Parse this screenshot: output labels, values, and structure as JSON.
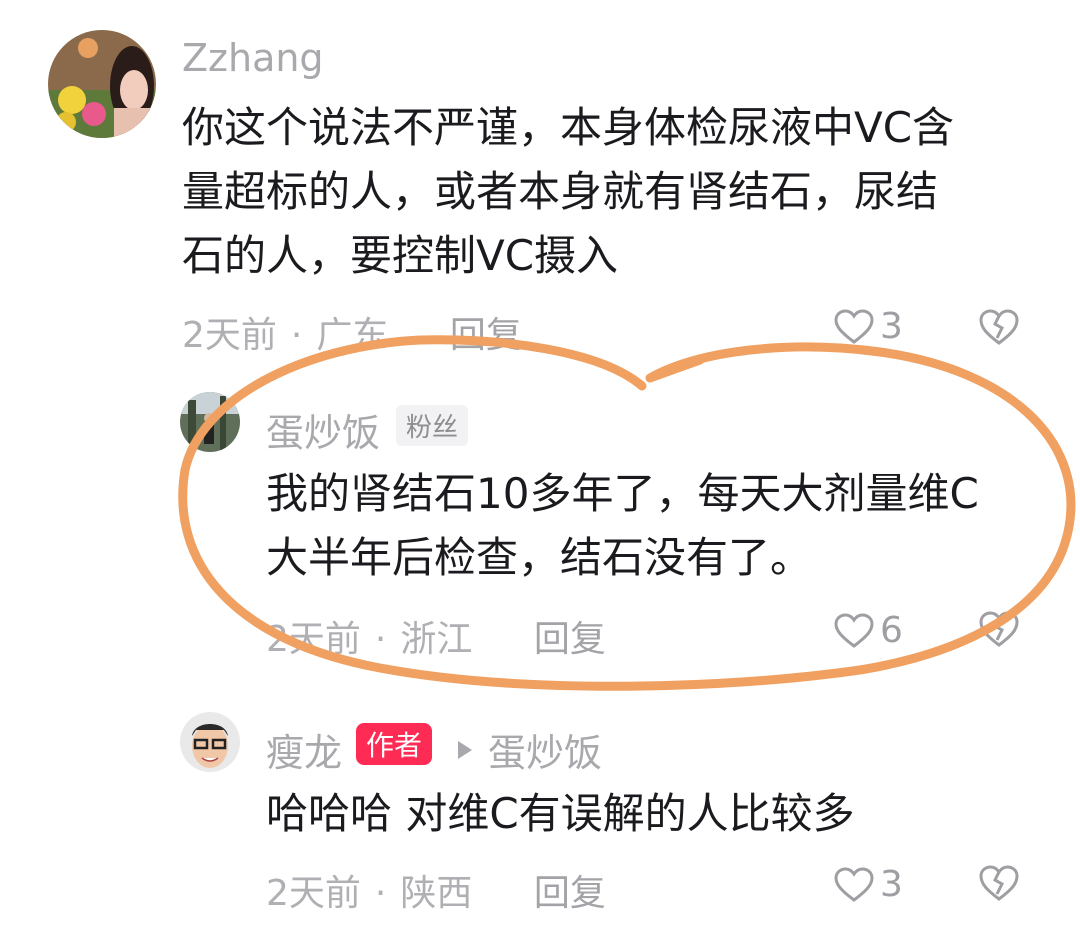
{
  "comments": [
    {
      "username": "Zzhang",
      "text_lines": [
        "你这个说法不严谨，本身体检尿液中VC含",
        "量超标的人，或者本身就有肾结石，尿结",
        "石的人，要控制VC摄入"
      ],
      "time": "2天前",
      "location": "广东",
      "reply_label": "回复",
      "likes": "3"
    },
    {
      "username": "蛋炒饭",
      "badge": "粉丝",
      "text_lines": [
        "我的肾结石10多年了，每天大剂量维C",
        "大半年后检查，结石没有了。"
      ],
      "time": "2天前",
      "location": "浙江",
      "reply_label": "回复",
      "likes": "6"
    },
    {
      "username": "瘦龙",
      "badge": "作者",
      "reply_to": "蛋炒饭",
      "text_lines": [
        "哈哈哈 对维C有误解的人比较多"
      ],
      "time": "2天前",
      "location": "陕西",
      "reply_label": "回复",
      "likes": "3"
    }
  ],
  "colors": {
    "annotation_circle": "#f0a060",
    "author_badge": "#fe2c55"
  },
  "icons": [
    "heart-outline-icon",
    "broken-heart-icon",
    "play-triangle-icon"
  ]
}
